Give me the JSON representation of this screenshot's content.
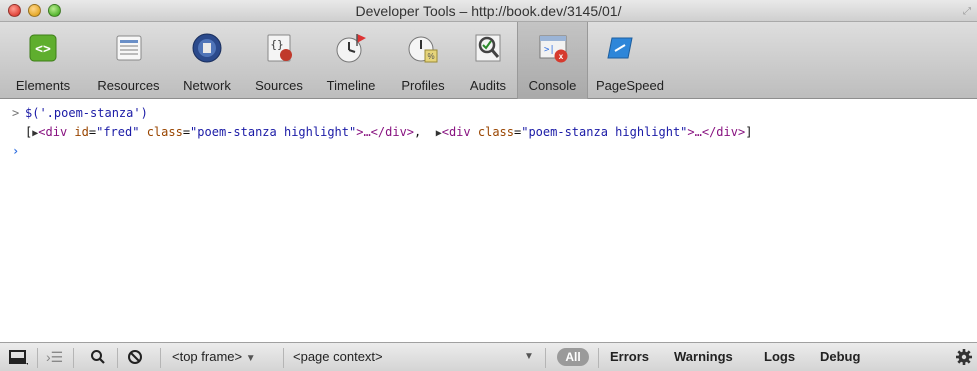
{
  "window": {
    "title": "Developer Tools – http://book.dev/3145/01/"
  },
  "toolbar": {
    "tabs": [
      {
        "label": "Elements",
        "icon": "elements-icon"
      },
      {
        "label": "Resources",
        "icon": "resources-icon"
      },
      {
        "label": "Network",
        "icon": "network-icon"
      },
      {
        "label": "Sources",
        "icon": "sources-icon"
      },
      {
        "label": "Timeline",
        "icon": "timeline-icon"
      },
      {
        "label": "Profiles",
        "icon": "profiles-icon"
      },
      {
        "label": "Audits",
        "icon": "audits-icon"
      },
      {
        "label": "Console",
        "icon": "console-icon",
        "selected": true
      },
      {
        "label": "PageSpeed",
        "icon": "pagespeed-icon"
      }
    ]
  },
  "console": {
    "prompt_symbol": ">",
    "command": "$('.poem-stanza')",
    "result": {
      "open_bracket": "[",
      "items": [
        {
          "tag_open": "<div",
          "attrs": [
            {
              "name": "id",
              "value": "\"fred\""
            },
            {
              "name": "class",
              "value": "\"poem-stanza highlight\""
            }
          ],
          "tag_close": ">…</div>"
        },
        {
          "tag_open": "<div",
          "attrs": [
            {
              "name": "class",
              "value": "\"poem-stanza highlight\""
            }
          ],
          "tag_close": ">…</div>"
        }
      ],
      "separator": ", ",
      "close_bracket": "]"
    },
    "input_prompt": "›"
  },
  "statusbar": {
    "frame_select": "<top frame>",
    "context_select": "<page context>",
    "filters": [
      "All",
      "Errors",
      "Warnings",
      "Logs",
      "Debug"
    ]
  },
  "colors": {
    "command_blue": "#1a1aa6",
    "tag_purple": "#881280",
    "attr_brown": "#994500",
    "prompt_blue": "#2f6ee0"
  }
}
